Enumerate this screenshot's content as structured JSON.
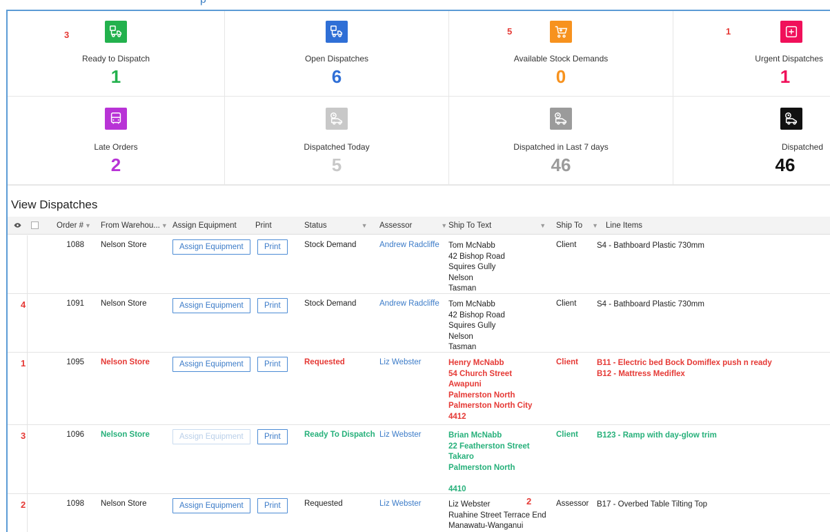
{
  "header": {
    "partial_title": "p"
  },
  "tiles_row1": [
    {
      "label": "Ready to Dispatch",
      "value": "1",
      "badge": "3",
      "color": "#23b14d",
      "icon": "truck-box-icon"
    },
    {
      "label": "Open Dispatches",
      "value": "6",
      "badge": "",
      "color": "#2f6fd6",
      "icon": "truck-box-icon"
    },
    {
      "label": "Available Stock Demands",
      "value": "0",
      "badge": "5",
      "color": "#f7921e",
      "icon": "cart-icon"
    },
    {
      "label": "Urgent Dispatches",
      "value": "1",
      "badge": "1",
      "color": "#f0105a",
      "icon": "medical-cross-icon"
    }
  ],
  "tiles_row2": [
    {
      "label": "Late Orders",
      "value": "2",
      "color": "#b833d6",
      "icon": "bus-icon"
    },
    {
      "label": "Dispatched Today",
      "value": "5",
      "color": "#c8c8c8",
      "icon": "truck-clock-icon"
    },
    {
      "label": "Dispatched in Last 7 days",
      "value": "46",
      "color": "#9b9b9b",
      "icon": "truck-clock-icon"
    },
    {
      "label": "Dispatched",
      "value": "46",
      "color": "#111111",
      "icon": "truck-clock-icon"
    }
  ],
  "section": {
    "title": "View Dispatches"
  },
  "columns": {
    "order": "Order #",
    "from": "From Warehou...",
    "assign": "Assign Equipment",
    "print": "Print",
    "status": "Status",
    "assessor": "Assessor",
    "ship_text": "Ship To Text",
    "ship_to": "Ship To",
    "line_items": "Line Items"
  },
  "rows": [
    {
      "badge": "",
      "order": "1088",
      "from": "Nelson Store",
      "assign": "Assign Equipment",
      "print": "Print",
      "status": "Stock Demand",
      "assessor": "Andrew Radcliffe",
      "ship_text": [
        "Tom McNabb",
        "42 Bishop Road",
        "Squires Gully",
        "Nelson",
        "Tasman"
      ],
      "ship_to": "Client",
      "line_items": [
        "S4 - Bathboard Plastic 730mm"
      ],
      "style": "normal"
    },
    {
      "badge": "4",
      "order": "1091",
      "from": "Nelson Store",
      "assign": "Assign Equipment",
      "print": "Print",
      "status": "Stock Demand",
      "assessor": "Andrew Radcliffe",
      "ship_text": [
        "Tom McNabb",
        "42 Bishop Road",
        "Squires Gully",
        "Nelson",
        "Tasman"
      ],
      "ship_to": "Client",
      "line_items": [
        "S4 - Bathboard Plastic 730mm"
      ],
      "style": "normal"
    },
    {
      "badge": "1",
      "order": "1095",
      "from": "Nelson Store",
      "assign": "Assign Equipment",
      "print": "Print",
      "status": "Requested",
      "assessor": "Liz Webster",
      "ship_text": [
        "Henry McNabb",
        "54 Church Street",
        "Awapuni",
        "Palmerston North",
        "Palmerston North City",
        "4412"
      ],
      "ship_to": "Client",
      "line_items": [
        "B11 - Electric bed Bock Domiflex push n ready",
        "B12 - Mattress Mediflex"
      ],
      "style": "red"
    },
    {
      "badge": "3",
      "order": "1096",
      "from": "Nelson Store",
      "assign": "Assign Equipment",
      "print": "Print",
      "status": "Ready To Dispatch",
      "assessor": "Liz Webster",
      "ship_text": [
        "Brian McNabb",
        "22 Featherston Street",
        "Takaro",
        "Palmerston North",
        "",
        "4410"
      ],
      "ship_to": "Client",
      "line_items": [
        "B123 - Ramp with day-glow trim"
      ],
      "style": "green"
    },
    {
      "badge": "2",
      "order": "1098",
      "from": "Nelson Store",
      "assign": "Assign Equipment",
      "print": "Print",
      "status": "Requested",
      "assessor": "Liz Webster",
      "ship_text": [
        "Liz Webster",
        "Ruahine Street Terrace End",
        "Manawatu-Wanganui"
      ],
      "ship_to": "Assessor",
      "line_items": [
        "B17 - Overbed Table Tilting Top"
      ],
      "style": "normal",
      "extra_badge": "2"
    }
  ]
}
